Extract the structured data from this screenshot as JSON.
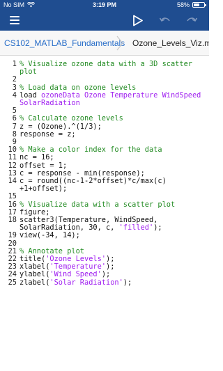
{
  "status_bar": {
    "carrier": "No SIM",
    "time": "3:19 PM",
    "battery": "58%",
    "battery_level": 0.58
  },
  "toolbar": {
    "menu_icon": "hamburger-menu-icon",
    "run_icon": "run-play-icon",
    "undo_icon": "undo-icon",
    "redo_icon": "redo-icon"
  },
  "breadcrumb": {
    "folder": "CS102_MATLAB_Fundamentals",
    "file": "Ozone_Levels_Viz.m"
  },
  "colors": {
    "header": "#1f4d90",
    "comment": "#228b22",
    "string": "#a020f0",
    "link": "#2a6fc9"
  },
  "code_lines": [
    {
      "no": "1",
      "segments": [
        {
          "type": "comment",
          "text": "% Visualize ozone data with a 3D scatter"
        }
      ]
    },
    {
      "no": "",
      "segments": [
        {
          "type": "comment",
          "text": "plot"
        }
      ]
    },
    {
      "no": "2",
      "segments": []
    },
    {
      "no": "3",
      "segments": [
        {
          "type": "comment",
          "text": "% Load data on ozone levels"
        }
      ]
    },
    {
      "no": "4",
      "segments": [
        {
          "type": "code",
          "text": "load "
        },
        {
          "type": "string",
          "text": "ozoneData Ozone Temperature WindSpeed"
        }
      ]
    },
    {
      "no": "",
      "segments": [
        {
          "type": "string",
          "text": "SolarRadiation"
        }
      ]
    },
    {
      "no": "5",
      "segments": []
    },
    {
      "no": "6",
      "segments": [
        {
          "type": "comment",
          "text": "% Calculate ozone levels"
        }
      ]
    },
    {
      "no": "7",
      "segments": [
        {
          "type": "code",
          "text": "z = (Ozone).^(1/3);"
        }
      ]
    },
    {
      "no": "8",
      "segments": [
        {
          "type": "code",
          "text": "response = z;"
        }
      ]
    },
    {
      "no": "9",
      "segments": []
    },
    {
      "no": "10",
      "segments": [
        {
          "type": "comment",
          "text": "% Make a color index for the data"
        }
      ]
    },
    {
      "no": "11",
      "segments": [
        {
          "type": "code",
          "text": "nc = 16;"
        }
      ]
    },
    {
      "no": "12",
      "segments": [
        {
          "type": "code",
          "text": "offset = 1;"
        }
      ]
    },
    {
      "no": "13",
      "segments": [
        {
          "type": "code",
          "text": "c = response - min(response);"
        }
      ]
    },
    {
      "no": "14",
      "segments": [
        {
          "type": "code",
          "text": "c = round((nc-1-2*offset)*c/max(c)"
        }
      ]
    },
    {
      "no": "",
      "segments": [
        {
          "type": "code",
          "text": "+1+offset);"
        }
      ]
    },
    {
      "no": "15",
      "segments": []
    },
    {
      "no": "16",
      "segments": [
        {
          "type": "comment",
          "text": "% Visualize data with a scatter plot"
        }
      ]
    },
    {
      "no": "17",
      "segments": [
        {
          "type": "code",
          "text": "figure;"
        }
      ]
    },
    {
      "no": "18",
      "segments": [
        {
          "type": "code",
          "text": "scatter3(Temperature, WindSpeed,"
        }
      ]
    },
    {
      "no": "",
      "segments": [
        {
          "type": "code",
          "text": "SolarRadiation, 30, c, "
        },
        {
          "type": "string",
          "text": "'filled'"
        },
        {
          "type": "code",
          "text": ");"
        }
      ]
    },
    {
      "no": "19",
      "segments": [
        {
          "type": "code",
          "text": "view(-34, 14);"
        }
      ]
    },
    {
      "no": "20",
      "segments": []
    },
    {
      "no": "21",
      "segments": [
        {
          "type": "comment",
          "text": "% Annotate plot"
        }
      ]
    },
    {
      "no": "22",
      "segments": [
        {
          "type": "code",
          "text": "title("
        },
        {
          "type": "string",
          "text": "'Ozone Levels'"
        },
        {
          "type": "code",
          "text": ");"
        }
      ]
    },
    {
      "no": "23",
      "segments": [
        {
          "type": "code",
          "text": "xlabel("
        },
        {
          "type": "string",
          "text": "'Temperature'"
        },
        {
          "type": "code",
          "text": ");"
        }
      ]
    },
    {
      "no": "24",
      "segments": [
        {
          "type": "code",
          "text": "ylabel("
        },
        {
          "type": "string",
          "text": "'Wind Speed'"
        },
        {
          "type": "code",
          "text": ");"
        }
      ]
    },
    {
      "no": "25",
      "segments": [
        {
          "type": "code",
          "text": "zlabel("
        },
        {
          "type": "string",
          "text": "'Solar Radiation'"
        },
        {
          "type": "code",
          "text": ");"
        }
      ]
    }
  ]
}
